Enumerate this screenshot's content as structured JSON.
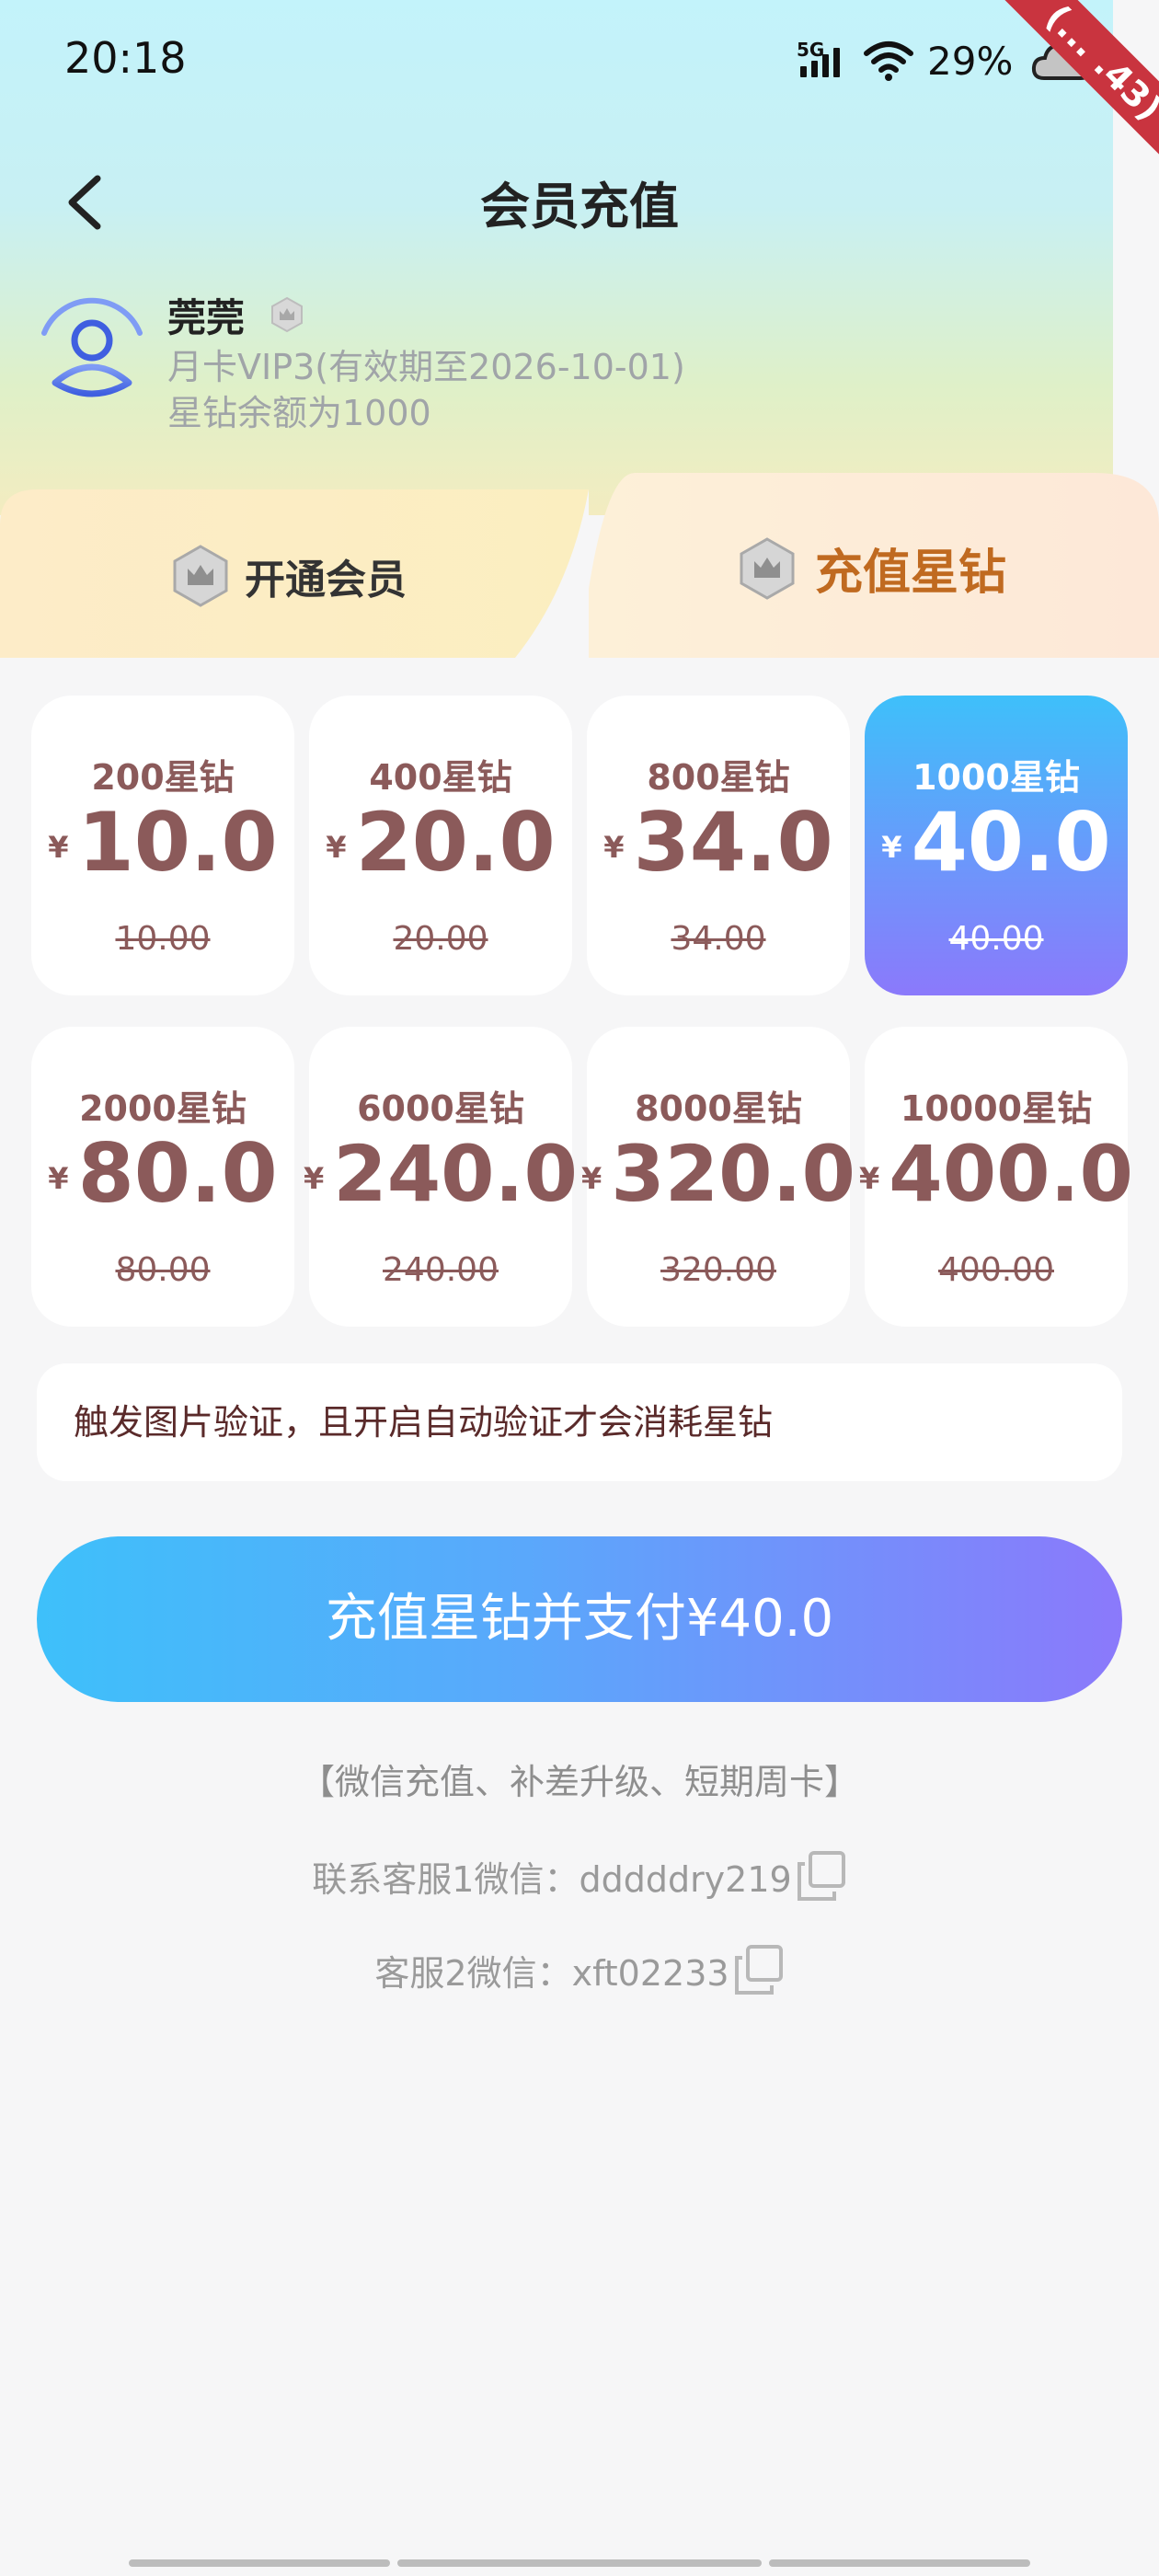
{
  "status_bar": {
    "time": "20:18",
    "network": "5G",
    "battery": "29%",
    "ribbon": "(... .43)"
  },
  "header": {
    "title": "会员充值"
  },
  "user": {
    "name": "莞莞",
    "vip": "月卡VIP3(有效期至2026-10-01)",
    "balance": "星钻余额为1000"
  },
  "tabs": [
    {
      "label": "开通会员",
      "active": false
    },
    {
      "label": "充值星钻",
      "active": true
    }
  ],
  "packages": [
    {
      "name": "200星钻",
      "currency": "¥",
      "price": "10.0",
      "original": "10.00"
    },
    {
      "name": "400星钻",
      "currency": "¥",
      "price": "20.0",
      "original": "20.00"
    },
    {
      "name": "800星钻",
      "currency": "¥",
      "price": "34.0",
      "original": "34.00"
    },
    {
      "name": "1000星钻",
      "currency": "¥",
      "price": "40.0",
      "original": "40.00",
      "selected": true
    },
    {
      "name": "2000星钻",
      "currency": "¥",
      "price": "80.0",
      "original": "80.00"
    },
    {
      "name": "6000星钻",
      "currency": "¥",
      "price": "240.0",
      "original": "240.00"
    },
    {
      "name": "8000星钻",
      "currency": "¥",
      "price": "320.0",
      "original": "320.00"
    },
    {
      "name": "10000星钻",
      "currency": "¥",
      "price": "400.0",
      "original": "400.00"
    }
  ],
  "notice": "触发图片验证，且开启自动验证才会消耗星钻",
  "pay_button": "充值星钻并支付¥40.0",
  "footer": {
    "note": "【微信充值、补差升级、短期周卡】",
    "contact1": "联系客服1微信：dddddry219",
    "contact2": "客服2微信：xft02233"
  },
  "colors": {
    "accent_start": "#3ec0fa",
    "accent_end": "#8b79fb",
    "price_text": "#8b5a5a",
    "tab_active_text": "#c06a20"
  }
}
